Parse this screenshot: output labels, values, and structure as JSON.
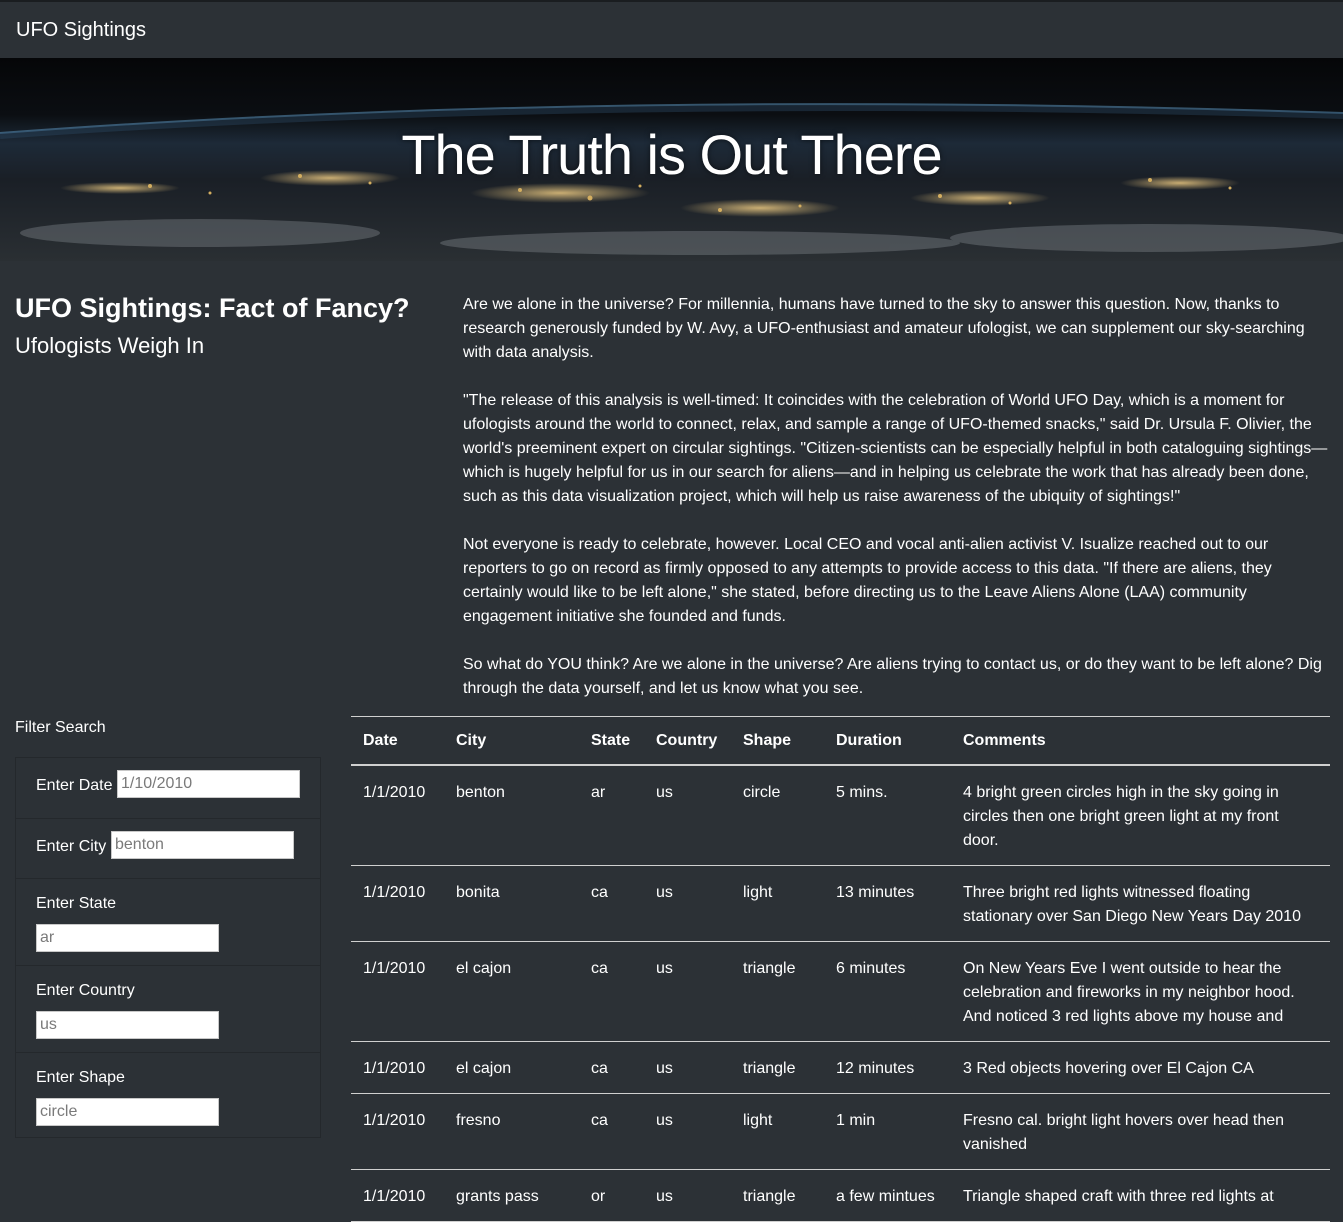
{
  "navbar": {
    "brand": "UFO Sightings"
  },
  "hero": {
    "title": "The Truth is Out There"
  },
  "article": {
    "title": "UFO Sightings: Fact of Fancy?",
    "subtitle": "Ufologists Weigh In",
    "paragraphs": [
      "Are we alone in the universe? For millennia, humans have turned to the sky to answer this question. Now, thanks to research generously funded by W. Avy, a UFO-enthusiast and amateur ufologist, we can supplement our sky-searching with data analysis.",
      "\"The release of this analysis is well-timed: It coincides with the celebration of World UFO Day, which is a moment for ufologists around the world to connect, relax, and sample a range of UFO-themed snacks,\" said Dr. Ursula F. Olivier, the world's preeminent expert on circular sightings. \"Citizen-scientists can be especially helpful in both cataloguing sightings—which is hugely helpful for us in our search for aliens—and in helping us celebrate the work that has already been done, such as this data visualization project, which will help us raise awareness of the ubiquity of sightings!\"",
      "Not everyone is ready to celebrate, however. Local CEO and vocal anti-alien activist V. Isualize reached out to our reporters to go on record as firmly opposed to any attempts to provide access to this data. \"If there are aliens, they certainly would like to be left alone,\" she stated, before directing us to the Leave Aliens Alone (LAA) community engagement initiative she founded and funds.",
      "So what do YOU think? Are we alone in the universe? Are aliens trying to contact us, or do they want to be left alone? Dig through the data yourself, and let us know what you see."
    ]
  },
  "filters": {
    "heading": "Filter Search",
    "date": {
      "label": "Enter Date",
      "placeholder": "1/10/2010"
    },
    "city": {
      "label": "Enter City",
      "placeholder": "benton"
    },
    "state": {
      "label": "Enter State",
      "placeholder": "ar"
    },
    "country": {
      "label": "Enter Country",
      "placeholder": "us"
    },
    "shape": {
      "label": "Enter Shape",
      "placeholder": "circle"
    }
  },
  "table": {
    "headers": [
      "Date",
      "City",
      "State",
      "Country",
      "Shape",
      "Duration",
      "Comments"
    ],
    "rows": [
      [
        "1/1/2010",
        "benton",
        "ar",
        "us",
        "circle",
        "5 mins.",
        "4 bright green circles high in the sky going in circles then one bright green light at my front door."
      ],
      [
        "1/1/2010",
        "bonita",
        "ca",
        "us",
        "light",
        "13 minutes",
        "Three bright red lights witnessed floating stationary over San Diego New Years Day 2010"
      ],
      [
        "1/1/2010",
        "el cajon",
        "ca",
        "us",
        "triangle",
        "6 minutes",
        "On New Years Eve I went outside to hear the celebration and fireworks in my neighbor hood. And noticed 3 red lights above my house and"
      ],
      [
        "1/1/2010",
        "el cajon",
        "ca",
        "us",
        "triangle",
        "12 minutes",
        "3 Red objects hovering over El Cajon CA"
      ],
      [
        "1/1/2010",
        "fresno",
        "ca",
        "us",
        "light",
        "1 min",
        "Fresno cal. bright light hovers over head then vanished"
      ],
      [
        "1/1/2010",
        "grants pass",
        "or",
        "us",
        "triangle",
        "a few mintues",
        "Triangle shaped craft with three red lights at"
      ]
    ]
  }
}
